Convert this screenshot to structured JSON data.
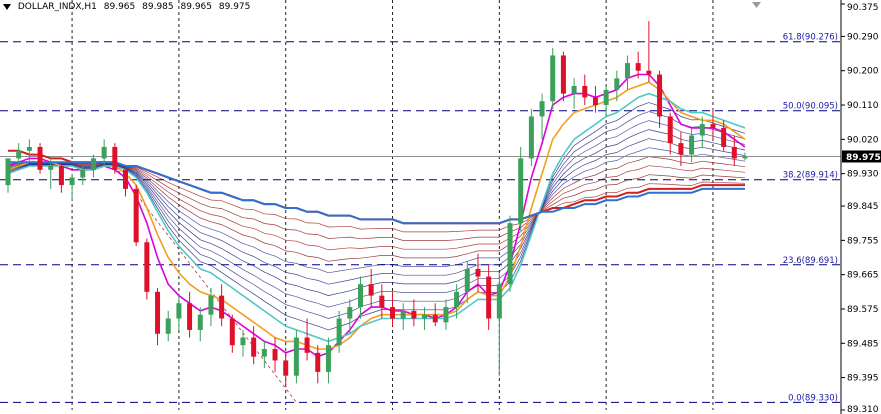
{
  "header": {
    "symbol": "DOLLAR_INDX,H1",
    "open": "89.965",
    "high": "89.985",
    "low": "89.965",
    "close": "89.975"
  },
  "current_price_label": "89.975",
  "chart_data": {
    "type": "candlestick",
    "title": "",
    "xlabel": "",
    "ylabel": "",
    "ylim": [
      89.31,
      90.375
    ],
    "grid": true,
    "y_ticks": [
      "90.375",
      "90.290",
      "90.200",
      "90.110",
      "90.020",
      "89.930",
      "89.845",
      "89.755",
      "89.665",
      "89.575",
      "89.485",
      "89.395",
      "89.310"
    ],
    "fib_levels": [
      {
        "label": "61.8(90.276)",
        "value": 90.276
      },
      {
        "label": "50.0(90.095)",
        "value": 90.095
      },
      {
        "label": "38.2(89.914)",
        "value": 89.914
      },
      {
        "label": "23.6(89.691)",
        "value": 89.691
      },
      {
        "label": "0.0(89.330)",
        "value": 89.33
      }
    ],
    "current_price": 89.975,
    "candles": [
      [
        89.9,
        89.965,
        89.88,
        89.97
      ],
      [
        89.97,
        90.01,
        89.95,
        89.99
      ],
      [
        89.99,
        90.02,
        89.96,
        90.0
      ],
      [
        90.0,
        90.01,
        89.93,
        89.94
      ],
      [
        89.94,
        89.97,
        89.89,
        89.95
      ],
      [
        89.95,
        89.96,
        89.88,
        89.9
      ],
      [
        89.9,
        89.93,
        89.86,
        89.92
      ],
      [
        89.92,
        89.95,
        89.9,
        89.94
      ],
      [
        89.94,
        89.98,
        89.92,
        89.97
      ],
      [
        89.97,
        90.02,
        89.95,
        90.0
      ],
      [
        90.0,
        90.01,
        89.93,
        89.94
      ],
      [
        89.94,
        89.95,
        89.87,
        89.89
      ],
      [
        89.89,
        89.9,
        89.74,
        89.75
      ],
      [
        89.75,
        89.76,
        89.6,
        89.62
      ],
      [
        89.62,
        89.63,
        89.48,
        89.51
      ],
      [
        89.51,
        89.57,
        89.49,
        89.55
      ],
      [
        89.55,
        89.61,
        89.52,
        89.59
      ],
      [
        89.59,
        89.62,
        89.5,
        89.52
      ],
      [
        89.52,
        89.58,
        89.49,
        89.56
      ],
      [
        89.56,
        89.63,
        89.53,
        89.61
      ],
      [
        89.61,
        89.64,
        89.53,
        89.55
      ],
      [
        89.55,
        89.56,
        89.46,
        89.48
      ],
      [
        89.48,
        89.52,
        89.45,
        89.5
      ],
      [
        89.5,
        89.53,
        89.43,
        89.45
      ],
      [
        89.45,
        89.49,
        89.42,
        89.47
      ],
      [
        89.47,
        89.5,
        89.41,
        89.44
      ],
      [
        89.44,
        89.46,
        89.37,
        89.4
      ],
      [
        89.4,
        89.52,
        89.38,
        89.5
      ],
      [
        89.5,
        89.55,
        89.44,
        89.46
      ],
      [
        89.46,
        89.48,
        89.38,
        89.41
      ],
      [
        89.41,
        89.5,
        89.38,
        89.48
      ],
      [
        89.48,
        89.57,
        89.46,
        89.55
      ],
      [
        89.55,
        89.6,
        89.51,
        89.58
      ],
      [
        89.58,
        89.66,
        89.55,
        89.64
      ],
      [
        89.64,
        89.68,
        89.58,
        89.61
      ],
      [
        89.61,
        89.64,
        89.55,
        89.58
      ],
      [
        89.58,
        89.62,
        89.53,
        89.55
      ],
      [
        89.55,
        89.59,
        89.52,
        89.57
      ],
      [
        89.57,
        89.6,
        89.53,
        89.55
      ],
      [
        89.55,
        89.58,
        89.52,
        89.56
      ],
      [
        89.56,
        89.59,
        89.53,
        89.54
      ],
      [
        89.54,
        89.6,
        89.52,
        89.58
      ],
      [
        89.58,
        89.64,
        89.55,
        89.62
      ],
      [
        89.62,
        89.7,
        89.59,
        89.68
      ],
      [
        89.68,
        89.72,
        89.62,
        89.66
      ],
      [
        89.66,
        89.69,
        89.52,
        89.55
      ],
      [
        89.55,
        89.67,
        89.4,
        89.64
      ],
      [
        89.64,
        89.82,
        89.62,
        89.8
      ],
      [
        89.8,
        90.0,
        89.78,
        89.97
      ],
      [
        89.97,
        90.1,
        89.95,
        90.08
      ],
      [
        90.08,
        90.14,
        90.02,
        90.12
      ],
      [
        90.12,
        90.26,
        90.1,
        90.24
      ],
      [
        90.24,
        90.25,
        90.12,
        90.14
      ],
      [
        90.14,
        90.18,
        90.1,
        90.16
      ],
      [
        90.16,
        90.19,
        90.11,
        90.13
      ],
      [
        90.13,
        90.16,
        90.09,
        90.11
      ],
      [
        90.11,
        90.16,
        90.08,
        90.15
      ],
      [
        90.15,
        90.2,
        90.12,
        90.18
      ],
      [
        90.18,
        90.24,
        90.15,
        90.22
      ],
      [
        90.22,
        90.25,
        90.18,
        90.2
      ],
      [
        90.2,
        90.33,
        90.17,
        90.19
      ],
      [
        90.19,
        90.2,
        90.05,
        90.08
      ],
      [
        90.08,
        90.09,
        89.98,
        90.01
      ],
      [
        90.01,
        90.04,
        89.95,
        89.98
      ],
      [
        89.98,
        90.05,
        89.96,
        90.03
      ],
      [
        90.03,
        90.08,
        90.0,
        90.06
      ],
      [
        90.06,
        90.1,
        90.02,
        90.05
      ],
      [
        90.05,
        90.07,
        89.99,
        90.0
      ],
      [
        90.0,
        90.03,
        89.95,
        89.97
      ],
      [
        89.97,
        89.985,
        89.965,
        89.975
      ]
    ],
    "moving_averages": [
      {
        "color": "#dd00dd",
        "values": [
          89.95,
          89.96,
          89.97,
          89.97,
          89.96,
          89.95,
          89.94,
          89.94,
          89.94,
          89.95,
          89.94,
          89.92,
          89.87,
          89.8,
          89.71,
          89.64,
          89.61,
          89.59,
          89.57,
          89.58,
          89.57,
          89.55,
          89.53,
          89.51,
          89.49,
          89.48,
          89.46,
          89.47,
          89.47,
          89.45,
          89.46,
          89.49,
          89.52,
          89.56,
          89.58,
          89.58,
          89.57,
          89.57,
          89.56,
          89.56,
          89.55,
          89.56,
          89.58,
          89.62,
          89.64,
          89.61,
          89.62,
          89.69,
          89.8,
          89.92,
          90.01,
          90.11,
          90.13,
          90.14,
          90.14,
          90.13,
          90.14,
          90.15,
          90.18,
          90.19,
          90.19,
          90.16,
          90.11,
          90.06,
          90.05,
          90.05,
          90.05,
          90.04,
          90.02,
          90.0
        ]
      },
      {
        "color": "#f0a020",
        "values": [
          89.94,
          89.95,
          89.96,
          89.96,
          89.96,
          89.95,
          89.95,
          89.94,
          89.94,
          89.95,
          89.95,
          89.93,
          89.9,
          89.84,
          89.77,
          89.71,
          89.67,
          89.64,
          89.62,
          89.61,
          89.6,
          89.58,
          89.56,
          89.54,
          89.52,
          89.5,
          89.49,
          89.49,
          89.48,
          89.47,
          89.47,
          89.48,
          89.5,
          89.53,
          89.55,
          89.56,
          89.56,
          89.56,
          89.56,
          89.56,
          89.56,
          89.56,
          89.57,
          89.6,
          89.62,
          89.61,
          89.61,
          89.66,
          89.74,
          89.84,
          89.93,
          90.02,
          90.06,
          90.09,
          90.1,
          90.11,
          90.12,
          90.13,
          90.15,
          90.16,
          90.17,
          90.15,
          90.12,
          90.09,
          90.08,
          90.07,
          90.07,
          90.06,
          90.04,
          90.02
        ]
      },
      {
        "color": "#50c8c8",
        "values": [
          89.93,
          89.94,
          89.95,
          89.95,
          89.95,
          89.95,
          89.95,
          89.94,
          89.94,
          89.95,
          89.95,
          89.94,
          89.92,
          89.88,
          89.83,
          89.78,
          89.74,
          89.71,
          89.68,
          89.67,
          89.65,
          89.63,
          89.61,
          89.59,
          89.57,
          89.55,
          89.53,
          89.52,
          89.51,
          89.5,
          89.49,
          89.5,
          89.51,
          89.53,
          89.54,
          89.55,
          89.55,
          89.55,
          89.55,
          89.55,
          89.55,
          89.55,
          89.56,
          89.58,
          89.6,
          89.6,
          89.6,
          89.63,
          89.69,
          89.77,
          89.85,
          89.93,
          89.98,
          90.02,
          90.04,
          90.06,
          90.08,
          90.09,
          90.11,
          90.13,
          90.14,
          90.13,
          90.12,
          90.1,
          90.09,
          90.09,
          90.08,
          90.07,
          90.06,
          90.05
        ]
      },
      {
        "color": "#d02020",
        "values": [
          89.99,
          89.99,
          89.98,
          89.98,
          89.97,
          89.97,
          89.96,
          89.96,
          89.96,
          89.96,
          89.96,
          89.95,
          89.95,
          89.94,
          89.93,
          89.92,
          89.91,
          89.9,
          89.89,
          89.88,
          89.88,
          89.87,
          89.86,
          89.86,
          89.85,
          89.85,
          89.84,
          89.84,
          89.83,
          89.83,
          89.82,
          89.82,
          89.82,
          89.81,
          89.81,
          89.81,
          89.81,
          89.8,
          89.8,
          89.8,
          89.8,
          89.8,
          89.8,
          89.8,
          89.8,
          89.8,
          89.8,
          89.81,
          89.81,
          89.82,
          89.83,
          89.84,
          89.84,
          89.85,
          89.86,
          89.86,
          89.87,
          89.87,
          89.88,
          89.88,
          89.89,
          89.89,
          89.89,
          89.89,
          89.89,
          89.9,
          89.9,
          89.9,
          89.9,
          89.9
        ]
      },
      {
        "color": "#3070d0",
        "values": [
          89.96,
          89.96,
          89.96,
          89.96,
          89.96,
          89.96,
          89.96,
          89.96,
          89.96,
          89.96,
          89.96,
          89.95,
          89.95,
          89.94,
          89.93,
          89.92,
          89.91,
          89.9,
          89.89,
          89.88,
          89.88,
          89.87,
          89.86,
          89.86,
          89.85,
          89.85,
          89.84,
          89.84,
          89.83,
          89.83,
          89.82,
          89.82,
          89.82,
          89.81,
          89.81,
          89.81,
          89.81,
          89.8,
          89.8,
          89.8,
          89.8,
          89.8,
          89.8,
          89.8,
          89.8,
          89.8,
          89.8,
          89.81,
          89.81,
          89.82,
          89.83,
          89.83,
          89.84,
          89.84,
          89.85,
          89.85,
          89.86,
          89.86,
          89.87,
          89.87,
          89.88,
          89.88,
          89.88,
          89.88,
          89.88,
          89.89,
          89.89,
          89.89,
          89.89,
          89.89
        ]
      }
    ]
  }
}
